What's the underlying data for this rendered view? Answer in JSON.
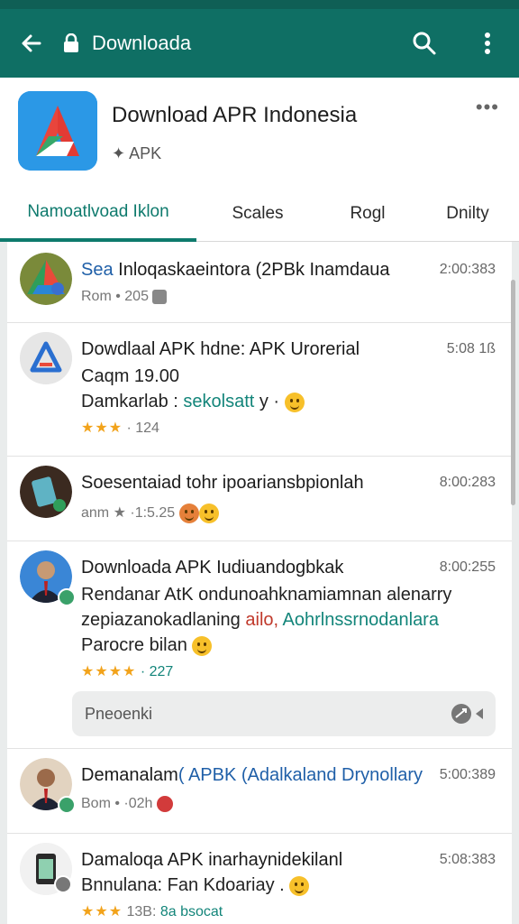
{
  "appbar": {
    "title": "Downloada",
    "back_icon": "arrow-left-icon",
    "lock_icon": "lock-icon",
    "search_icon": "search-icon",
    "menu_icon": "more-vertical-icon",
    "color": "#0f6f64"
  },
  "header": {
    "app_name": "Download APR Indonesia",
    "app_sub": "APK",
    "more": "•••"
  },
  "tabs": [
    {
      "label": "Namoatlvoad Iklon",
      "active": true
    },
    {
      "label": "Scales",
      "active": false
    },
    {
      "label": "Rogl",
      "active": false
    },
    {
      "label": "Dnilty",
      "active": false
    }
  ],
  "rows": [
    {
      "title_a": "Sea",
      "title_b": " Inloqaskaeintora (2PBk Inamdaua",
      "time": "2:00:383",
      "meta": "Rom  •  205"
    },
    {
      "title": "Dowdlaal APK hdne: APK Urorerial",
      "line2": "Caqm 19.00",
      "line3_a": "Damkarlab : ",
      "line3_b": "sekolsatt",
      "line3_c": " y ·",
      "rating": "★★★",
      "meta": "· 124",
      "time": "5:08 1ß"
    },
    {
      "title": "Soesentaiad tohr ipoariansbpionlah",
      "meta": "anm  ★  ·1:5.25",
      "time": "8:00:283"
    },
    {
      "title": "Downloada APK Iudiuandogbkak",
      "line2": "Rendanar AtK ondunoahknamiamnan alenarry",
      "line3_a": "zepiazanokadlaning ",
      "line3_b": "ailo,",
      "line3_c": " Aohrlnssrnodanlara",
      "line4": "Parocre bilan",
      "rating": "★★★★",
      "meta": "· 227",
      "time": "8:00:255",
      "reply_placeholder": "Pneoenki"
    },
    {
      "title_a": "Demanalam",
      "title_b": "( APBK (Adalkaland Drynollary",
      "meta": "Bom  •  ·02h",
      "time": "5:00:389"
    },
    {
      "title": "Damaloqa APK inarhaynidekilanl",
      "line2": "Bnnulana: Fan Kdoariay .",
      "rating": "★★★",
      "meta": "13B: ",
      "meta_b": "8a bsocat",
      "time": "5:08:383"
    }
  ]
}
